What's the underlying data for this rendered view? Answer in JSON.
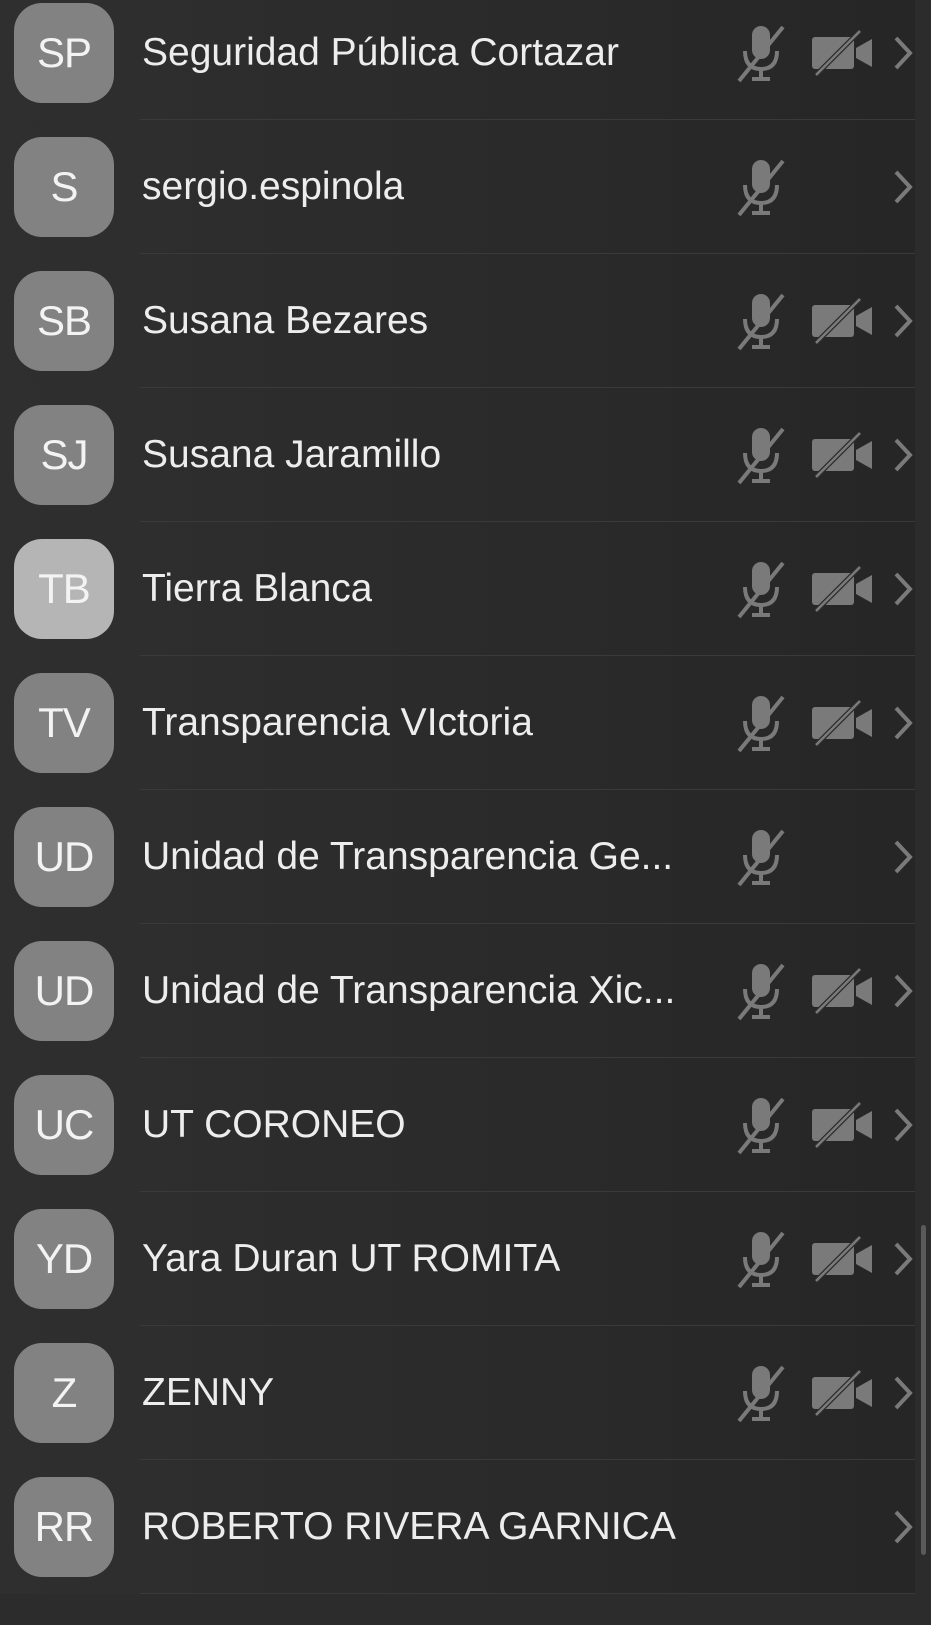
{
  "participants": [
    {
      "initials": "SP",
      "name": "Seguridad Pública Cortazar",
      "mic_muted": true,
      "camera_off": true,
      "avatar_style": "normal"
    },
    {
      "initials": "S",
      "name": "sergio.espinola",
      "mic_muted": true,
      "camera_off": null,
      "avatar_style": "normal"
    },
    {
      "initials": "SB",
      "name": "Susana Bezares",
      "mic_muted": true,
      "camera_off": true,
      "avatar_style": "normal"
    },
    {
      "initials": "SJ",
      "name": "Susana Jaramillo",
      "mic_muted": true,
      "camera_off": true,
      "avatar_style": "normal"
    },
    {
      "initials": "TB",
      "name": "Tierra Blanca",
      "mic_muted": true,
      "camera_off": true,
      "avatar_style": "light"
    },
    {
      "initials": "TV",
      "name": "Transparencia VIctoria",
      "mic_muted": true,
      "camera_off": true,
      "avatar_style": "normal"
    },
    {
      "initials": "UD",
      "name": "Unidad de Transparencia Ge...",
      "mic_muted": true,
      "camera_off": null,
      "avatar_style": "normal"
    },
    {
      "initials": "UD",
      "name": "Unidad de Transparencia Xic...",
      "mic_muted": true,
      "camera_off": true,
      "avatar_style": "normal"
    },
    {
      "initials": "UC",
      "name": "UT CORONEO",
      "mic_muted": true,
      "camera_off": true,
      "avatar_style": "normal"
    },
    {
      "initials": "YD",
      "name": "Yara Duran UT ROMITA",
      "mic_muted": true,
      "camera_off": true,
      "avatar_style": "normal"
    },
    {
      "initials": "Z",
      "name": "ZENNY",
      "mic_muted": true,
      "camera_off": true,
      "avatar_style": "normal"
    },
    {
      "initials": "RR",
      "name": "ROBERTO RIVERA GARNICA",
      "mic_muted": null,
      "camera_off": null,
      "avatar_style": "normal"
    }
  ],
  "icons": {
    "mic": "microphone-muted-icon",
    "camera": "camera-off-icon",
    "chevron": "chevron-right-icon"
  },
  "colors": {
    "background": "#2c2c2c",
    "avatar": "#828282",
    "avatar_light": "#b5b5b5",
    "text": "#ededed",
    "icon": "#7a7a7a"
  }
}
